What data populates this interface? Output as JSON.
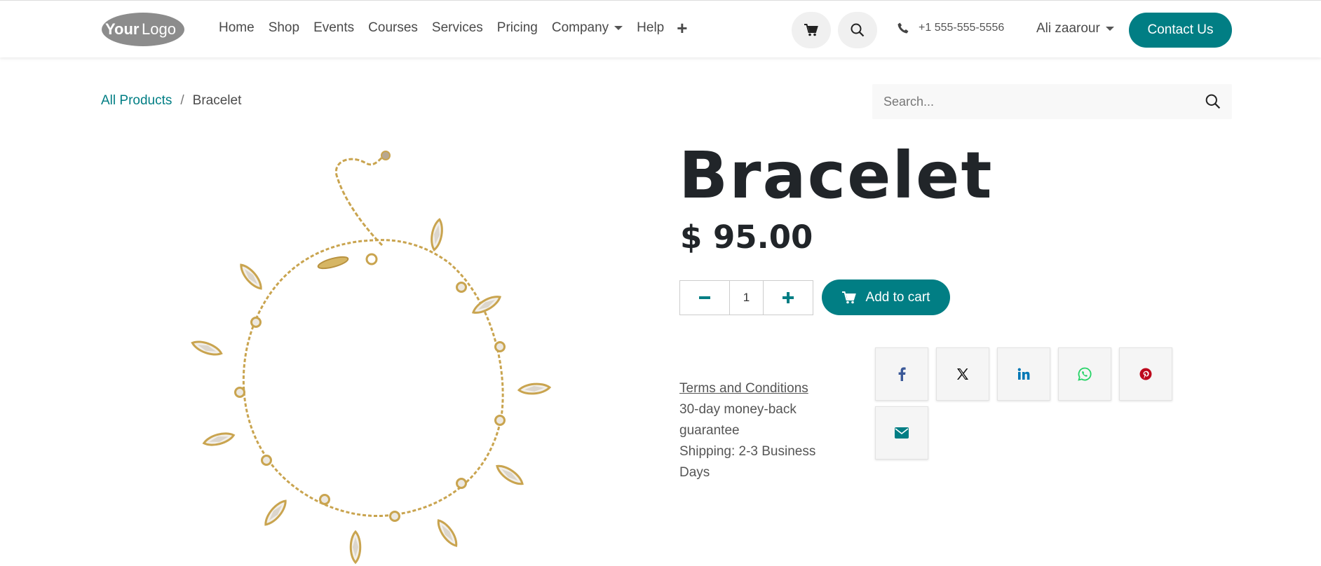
{
  "header": {
    "logo": {
      "text_your": "Your",
      "text_logo": "Logo"
    },
    "nav": [
      {
        "label": "Home"
      },
      {
        "label": "Shop"
      },
      {
        "label": "Events"
      },
      {
        "label": "Courses"
      },
      {
        "label": "Services"
      },
      {
        "label": "Pricing"
      },
      {
        "label": "Company"
      },
      {
        "label": "Help"
      }
    ],
    "phone": "+1 555-555-5556",
    "user": "Ali zaarour",
    "contact_label": "Contact Us"
  },
  "breadcrumb": {
    "parent": "All Products",
    "separator": "/",
    "current": "Bracelet"
  },
  "search": {
    "placeholder": "Search..."
  },
  "product": {
    "title": "Bracelet",
    "price": "$ 95.00",
    "quantity": "1",
    "add_to_cart": "Add to cart",
    "terms_link": "Terms and Conditions",
    "guarantee": "30-day money-back guarantee",
    "shipping": "Shipping: 2-3 Business Days"
  },
  "share": [
    {
      "icon": "facebook-icon",
      "color": "#3b5998"
    },
    {
      "icon": "x-icon",
      "color": "#000000"
    },
    {
      "icon": "linkedin-icon",
      "color": "#0077b5"
    },
    {
      "icon": "whatsapp-icon",
      "color": "#25d366"
    },
    {
      "icon": "pinterest-icon",
      "color": "#bd081c"
    },
    {
      "icon": "email-icon",
      "color": "#017e84"
    }
  ],
  "colors": {
    "accent": "#017e84"
  }
}
